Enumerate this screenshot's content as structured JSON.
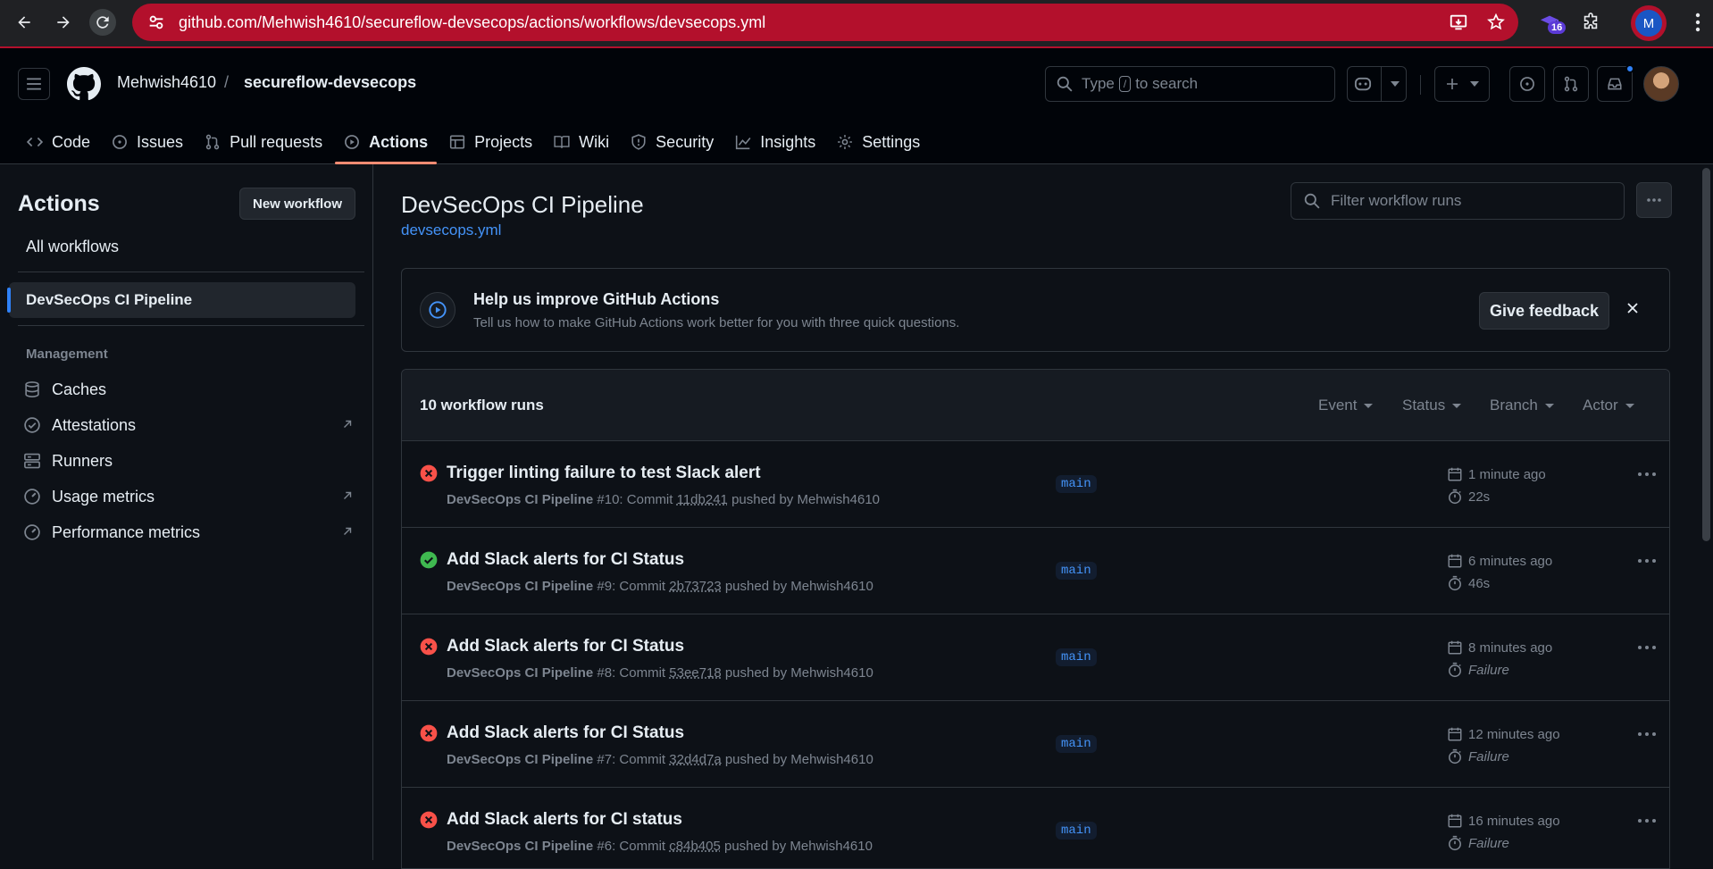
{
  "browser": {
    "url": "github.com/Mehwish4610/secureflow-devsecops/actions/workflows/devsecops.yml",
    "extension_badge": "16",
    "profile_initial": "M"
  },
  "header": {
    "owner": "Mehwish4610",
    "separator": "/",
    "repo": "secureflow-devsecops",
    "search_prefix": "Type",
    "search_key": "/",
    "search_suffix": "to search",
    "tabs": [
      {
        "label": "Code",
        "icon": "code-icon"
      },
      {
        "label": "Issues",
        "icon": "issue-icon"
      },
      {
        "label": "Pull requests",
        "icon": "pull-request-icon"
      },
      {
        "label": "Actions",
        "icon": "play-icon",
        "active": true
      },
      {
        "label": "Projects",
        "icon": "table-icon"
      },
      {
        "label": "Wiki",
        "icon": "book-icon"
      },
      {
        "label": "Security",
        "icon": "shield-icon"
      },
      {
        "label": "Insights",
        "icon": "graph-icon"
      },
      {
        "label": "Settings",
        "icon": "gear-icon"
      }
    ]
  },
  "sidebar": {
    "title": "Actions",
    "new_workflow": "New workflow",
    "all_workflows": "All workflows",
    "selected_workflow": "DevSecOps CI Pipeline",
    "management_heading": "Management",
    "management_items": [
      {
        "label": "Caches",
        "icon": "database-icon"
      },
      {
        "label": "Attestations",
        "icon": "verified-icon",
        "external": true
      },
      {
        "label": "Runners",
        "icon": "server-icon"
      },
      {
        "label": "Usage metrics",
        "icon": "meter-icon",
        "external": true
      },
      {
        "label": "Performance metrics",
        "icon": "meter-icon",
        "external": true
      }
    ]
  },
  "main": {
    "workflow_title": "DevSecOps CI Pipeline",
    "workflow_file": "devsecops.yml",
    "filter_placeholder": "Filter workflow runs",
    "banner": {
      "title": "Help us improve GitHub Actions",
      "description": "Tell us how to make GitHub Actions work better for you with three quick questions.",
      "feedback_button": "Give feedback"
    },
    "runs_count": "10 workflow runs",
    "filters": [
      "Event",
      "Status",
      "Branch",
      "Actor"
    ],
    "runs": [
      {
        "status": "failure",
        "title": "Trigger linting failure to test Slack alert",
        "workflow": "DevSecOps CI Pipeline",
        "run": "#10: Commit",
        "commit": "11db241",
        "pushed_by": "pushed by Mehwish4610",
        "branch": "main",
        "when": "1 minute ago",
        "duration": "22s"
      },
      {
        "status": "success",
        "title": "Add Slack alerts for CI Status",
        "workflow": "DevSecOps CI Pipeline",
        "run": "#9: Commit",
        "commit": "2b73723",
        "pushed_by": "pushed by Mehwish4610",
        "branch": "main",
        "when": "6 minutes ago",
        "duration": "46s"
      },
      {
        "status": "failure",
        "title": "Add Slack alerts for CI Status",
        "workflow": "DevSecOps CI Pipeline",
        "run": "#8: Commit",
        "commit": "53ee718",
        "pushed_by": "pushed by Mehwish4610",
        "branch": "main",
        "when": "8 minutes ago",
        "duration": "Failure"
      },
      {
        "status": "failure",
        "title": "Add Slack alerts for CI Status",
        "workflow": "DevSecOps CI Pipeline",
        "run": "#7: Commit",
        "commit": "32d4d7a",
        "pushed_by": "pushed by Mehwish4610",
        "branch": "main",
        "when": "12 minutes ago",
        "duration": "Failure"
      },
      {
        "status": "failure",
        "title": "Add Slack alerts for CI status",
        "workflow": "DevSecOps CI Pipeline",
        "run": "#6: Commit",
        "commit": "c84b405",
        "pushed_by": "pushed by Mehwish4610",
        "branch": "main",
        "when": "16 minutes ago",
        "duration": "Failure"
      }
    ]
  },
  "colors": {
    "omnibox": "#b3102c",
    "link": "#4493f8",
    "failure": "#f85149",
    "success": "#3fb950",
    "active_tab": "#fd8c73"
  }
}
